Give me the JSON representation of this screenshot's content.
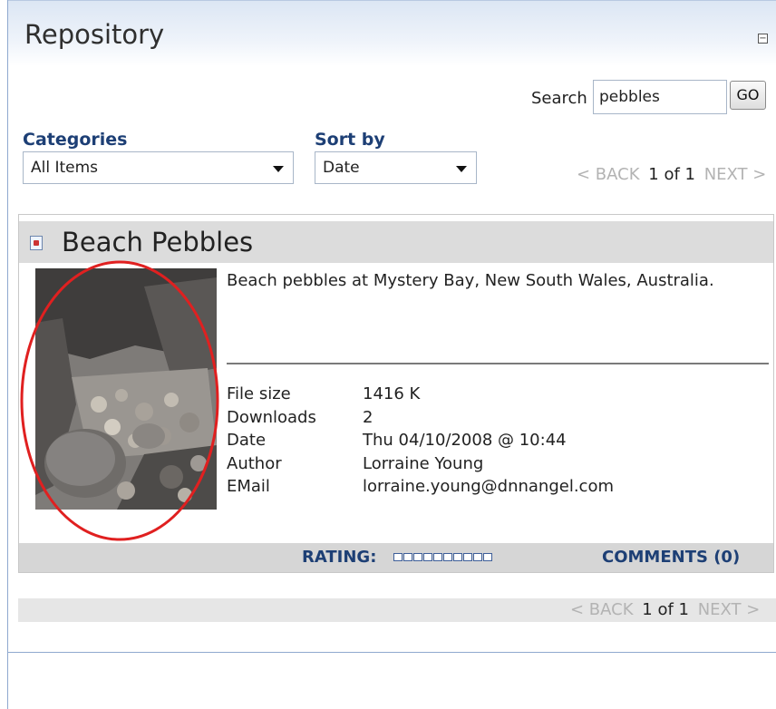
{
  "module": {
    "title": "Repository",
    "minimize_symbol": "−"
  },
  "search": {
    "label": "Search",
    "value": "pebbles",
    "button_label": "GO"
  },
  "filters": {
    "categories": {
      "label": "Categories",
      "selected": "All Items"
    },
    "sort_by": {
      "label": "Sort by",
      "selected": "Date"
    }
  },
  "pager": {
    "back": "< BACK",
    "page": "1 of 1",
    "next": "NEXT >"
  },
  "item": {
    "title": "Beach Pebbles",
    "icon": "document-icon",
    "description": "Beach pebbles at Mystery Bay, New South Wales, Australia.",
    "details": [
      {
        "label": "File size",
        "value": "1416 K"
      },
      {
        "label": "Downloads",
        "value": "2"
      },
      {
        "label": "Date",
        "value": "Thu 04/10/2008 @ 10:44"
      },
      {
        "label": "Author",
        "value": "Lorraine Young"
      },
      {
        "label": "EMail",
        "value": "lorraine.young@dnnangel.com"
      }
    ],
    "rating_label": "RATING:",
    "rating_value": 0,
    "rating_max": 10,
    "comments_label": "COMMENTS (0)"
  },
  "colors": {
    "accent": "#1d3f75",
    "annotation_circle": "#e02020",
    "border": "#8fa9cf"
  }
}
